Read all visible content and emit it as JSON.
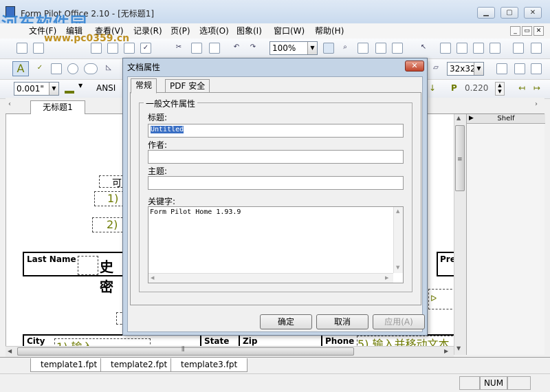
{
  "window": {
    "title": "Form Pilot Office 2.10 - [无标题1]",
    "watermark_logo": "河东软件园",
    "watermark_url": "www.pc0359.cn"
  },
  "menu": [
    "文件(F)",
    "编辑",
    "查看(V)",
    "记录(R)",
    "页(P)",
    "选项(O)",
    "图象(I)",
    "窗口(W)",
    "帮助(H)"
  ],
  "toolbar": {
    "zoom": "100%",
    "icon_size": "32x32",
    "line_width": "0.001\"",
    "charset": "ANSI",
    "position_label": "P",
    "position_value": "0.220"
  },
  "doc_tab": "无标题1",
  "form": {
    "labels": [
      "可",
      "1)",
      "2)"
    ],
    "cells": [
      "Last Name",
      "史密",
      "Pre",
      "City",
      "State",
      "Zip",
      "Phone"
    ],
    "green_text": [
      "1) 输入",
      "5) 输入并移动文本"
    ]
  },
  "shelf": {
    "title": "Shelf"
  },
  "bottom_tabs": [
    "template1.fpt",
    "template2.fpt",
    "template3.fpt"
  ],
  "status": {
    "num": "NUM"
  },
  "dialog": {
    "title": "文档属性",
    "tabs": [
      "常规",
      "PDF 安全"
    ],
    "group_title": "一般文件属性",
    "fields": {
      "title_label": "标题:",
      "title_value": "Untitled",
      "author_label": "作者:",
      "author_value": "",
      "subject_label": "主题:",
      "subject_value": "",
      "keywords_label": "关键字:",
      "keywords_value": "Form Pilot Home 1.93.9"
    },
    "buttons": {
      "ok": "确定",
      "cancel": "取消",
      "apply": "应用(A)"
    }
  }
}
